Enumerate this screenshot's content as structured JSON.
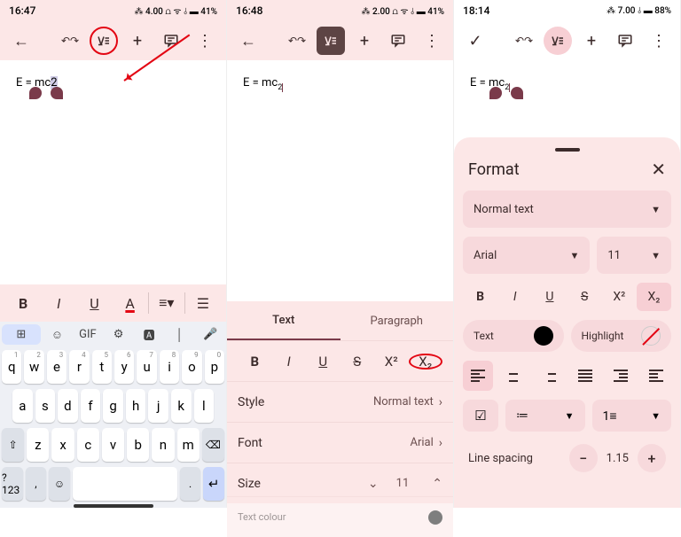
{
  "pane1": {
    "status": {
      "time": "16:47",
      "right": "⁂ 4.00 ⩍ ᯤ ⫰ ▬ 41%"
    },
    "doc_text_pre": "E = mc",
    "doc_text_sel": "2",
    "fmt": {
      "bold": "B",
      "italic": "I",
      "underline": "U",
      "colorA": "A"
    },
    "keyboard": {
      "sugg_gif": "GIF",
      "row1": [
        [
          "q",
          "1"
        ],
        [
          "w",
          "2"
        ],
        [
          "e",
          "3"
        ],
        [
          "r",
          "4"
        ],
        [
          "t",
          "5"
        ],
        [
          "y",
          "6"
        ],
        [
          "u",
          "7"
        ],
        [
          "i",
          "8"
        ],
        [
          "o",
          "9"
        ],
        [
          "p",
          "0"
        ]
      ],
      "row2": [
        "a",
        "s",
        "d",
        "f",
        "g",
        "h",
        "j",
        "k",
        "l"
      ],
      "row3": [
        "z",
        "x",
        "c",
        "v",
        "b",
        "n",
        "m"
      ],
      "numkey": "?123",
      "comma": ",",
      "period": "."
    }
  },
  "pane2": {
    "status": {
      "time": "16:48",
      "right": "⁂ 2.00 ⩍ ᯤ ⫰ ▬ 41%"
    },
    "doc_text_pre": "E = mc",
    "doc_text_sub": "2",
    "tabs": {
      "text": "Text",
      "paragraph": "Paragraph"
    },
    "icons": {
      "bold": "B",
      "italic": "I",
      "underline": "U",
      "strike": "S",
      "sup": "X²",
      "sub": "X₂"
    },
    "rows": {
      "style_label": "Style",
      "style_val": "Normal text",
      "font_label": "Font",
      "font_val": "Arial",
      "size_label": "Size",
      "size_val": "11",
      "color_label": "Text colour"
    }
  },
  "pane3": {
    "status": {
      "time": "18:14",
      "right": "⁂ 7.00 ⫰ ▬ 88%"
    },
    "doc_text_pre": "E = mc",
    "doc_text_sub": "2",
    "sheet": {
      "title": "Format",
      "normal": "Normal text",
      "font": "Arial",
      "size": "11",
      "bold": "B",
      "italic": "I",
      "underline": "U",
      "strike": "S",
      "sup": "X²",
      "sub": "X₂",
      "text_color_label": "Text",
      "highlight_label": "Highlight",
      "line_spacing_label": "Line spacing",
      "line_spacing_val": "1.15"
    }
  }
}
